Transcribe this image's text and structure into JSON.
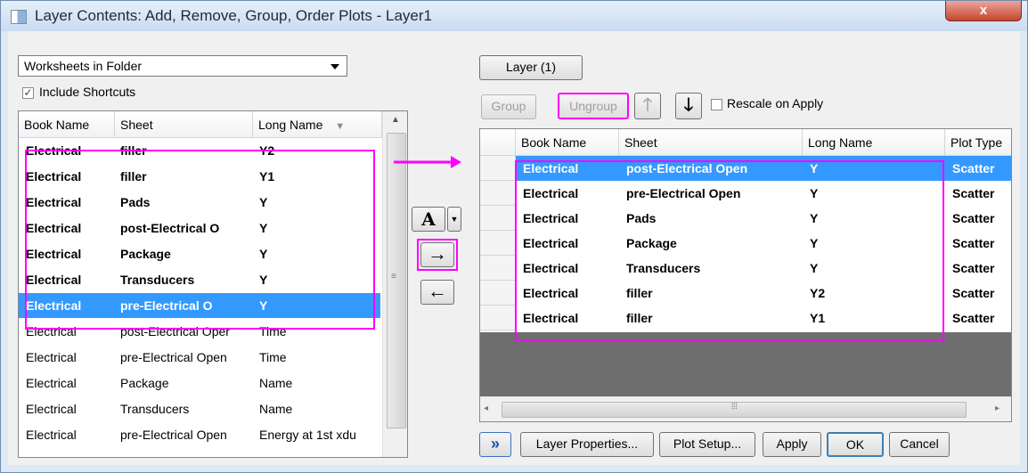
{
  "window": {
    "title": "Layer Contents: Add, Remove, Group, Order Plots - Layer1",
    "close_label": "x"
  },
  "left": {
    "source_select": "Worksheets in Folder",
    "include_shortcuts_label": "Include Shortcuts",
    "include_shortcuts_checked": true,
    "columns": [
      "Book Name",
      "Sheet",
      "Long Name"
    ],
    "rows": [
      {
        "book": "Electrical",
        "sheet": "filler",
        "long": "Y2",
        "bold": true,
        "selected": false
      },
      {
        "book": "Electrical",
        "sheet": "filler",
        "long": "Y1",
        "bold": true,
        "selected": false
      },
      {
        "book": "Electrical",
        "sheet": "Pads",
        "long": "Y",
        "bold": true,
        "selected": false
      },
      {
        "book": "Electrical",
        "sheet": "post-Electrical O",
        "long": "Y",
        "bold": true,
        "selected": false
      },
      {
        "book": "Electrical",
        "sheet": "Package",
        "long": "Y",
        "bold": true,
        "selected": false
      },
      {
        "book": "Electrical",
        "sheet": "Transducers",
        "long": "Y",
        "bold": true,
        "selected": false
      },
      {
        "book": "Electrical",
        "sheet": "pre-Electrical O",
        "long": "Y",
        "bold": true,
        "selected": true
      },
      {
        "book": "Electrical",
        "sheet": "post-Electrical Oper",
        "long": "Time",
        "bold": false,
        "selected": false
      },
      {
        "book": "Electrical",
        "sheet": "pre-Electrical Open",
        "long": "Time",
        "bold": false,
        "selected": false
      },
      {
        "book": "Electrical",
        "sheet": "Package",
        "long": "Name",
        "bold": false,
        "selected": false
      },
      {
        "book": "Electrical",
        "sheet": "Transducers",
        "long": "Name",
        "bold": false,
        "selected": false
      },
      {
        "book": "Electrical",
        "sheet": "pre-Electrical Open",
        "long": "Energy at 1st xdu",
        "bold": false,
        "selected": false
      }
    ]
  },
  "middle": {
    "font_button": "A",
    "add_arrow": "→",
    "remove_arrow": "←"
  },
  "right": {
    "layer_tab": "Layer (1)",
    "group_label": "Group",
    "ungroup_label": "Ungroup",
    "rescale_label": "Rescale on Apply",
    "rescale_checked": false,
    "columns": [
      "Book Name",
      "Sheet",
      "Long Name",
      "Plot Type"
    ],
    "rows": [
      {
        "book": "Electrical",
        "sheet": "post-Electrical Open",
        "long": "Y",
        "type": "Scatter",
        "selected": true
      },
      {
        "book": "Electrical",
        "sheet": "pre-Electrical Open",
        "long": "Y",
        "type": "Scatter",
        "selected": false
      },
      {
        "book": "Electrical",
        "sheet": "Pads",
        "long": "Y",
        "type": "Scatter",
        "selected": false
      },
      {
        "book": "Electrical",
        "sheet": "Package",
        "long": "Y",
        "type": "Scatter",
        "selected": false
      },
      {
        "book": "Electrical",
        "sheet": "Transducers",
        "long": "Y",
        "type": "Scatter",
        "selected": false
      },
      {
        "book": "Electrical",
        "sheet": "filler",
        "long": "Y2",
        "type": "Scatter",
        "selected": false
      },
      {
        "book": "Electrical",
        "sheet": "filler",
        "long": "Y1",
        "type": "Scatter",
        "selected": false
      }
    ]
  },
  "footer": {
    "expand_label": "»",
    "layer_properties_label": "Layer Properties...",
    "plot_setup_label": "Plot Setup...",
    "apply_label": "Apply",
    "ok_label": "OK",
    "cancel_label": "Cancel"
  },
  "colors": {
    "highlight": "#ff00ff",
    "selection": "#3399ff"
  }
}
